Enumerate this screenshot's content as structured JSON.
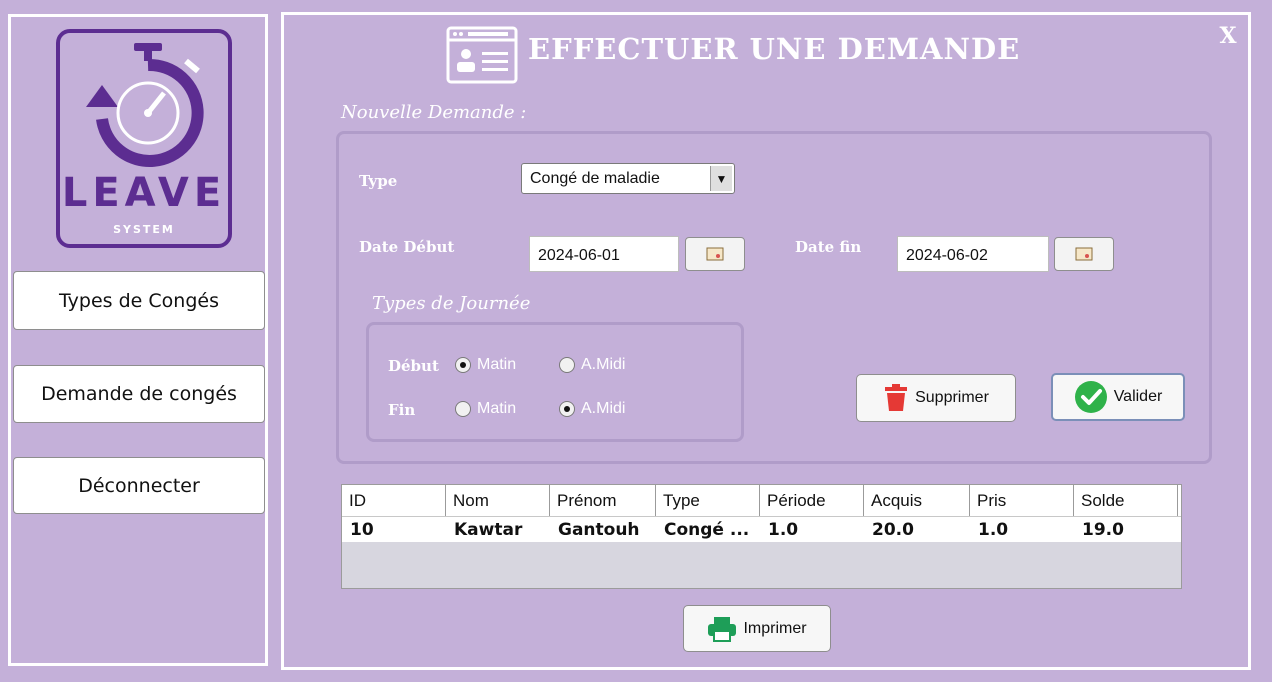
{
  "window": {
    "title": "EFFECTUER UNE DEMANDE",
    "close_label": "X"
  },
  "logo": {
    "word": "LEAVE",
    "sub": "SYSTEM",
    "icon": "stopwatch-refresh-icon"
  },
  "sidebar": {
    "items": [
      {
        "label": "Types de Congés"
      },
      {
        "label": "Demande de congés"
      },
      {
        "label": "Déconnecter"
      }
    ]
  },
  "form": {
    "section_title": "Nouvelle Demande :",
    "type_label": "Type",
    "type_value": "Congé de maladie",
    "date_debut_label": "Date Début",
    "date_debut_value": "2024-06-01",
    "date_fin_label": "Date fin",
    "date_fin_value": "2024-06-02",
    "journee_title": "Types de Journée",
    "debut_label": "Début",
    "fin_label": "Fin",
    "opt_matin": "Matin",
    "opt_amidi": "A.Midi",
    "debut_selected": "Matin",
    "fin_selected": "A.Midi",
    "delete_label": "Supprimer",
    "validate_label": "Valider"
  },
  "table": {
    "columns": [
      "ID",
      "Nom",
      "Prénom",
      "Type",
      "Période",
      "Acquis",
      "Pris",
      "Solde"
    ],
    "rows": [
      [
        "10",
        "Kawtar",
        "Gantouh",
        "Congé ...",
        "1.0",
        "20.0",
        "1.0",
        "19.0"
      ]
    ]
  },
  "footer": {
    "print_label": "Imprimer"
  },
  "colors": {
    "background": "#c4b0d9",
    "brand_purple": "#5c2d91",
    "delete_red": "#e53935",
    "validate_green": "#2fb24a",
    "print_green": "#1e9e58"
  }
}
